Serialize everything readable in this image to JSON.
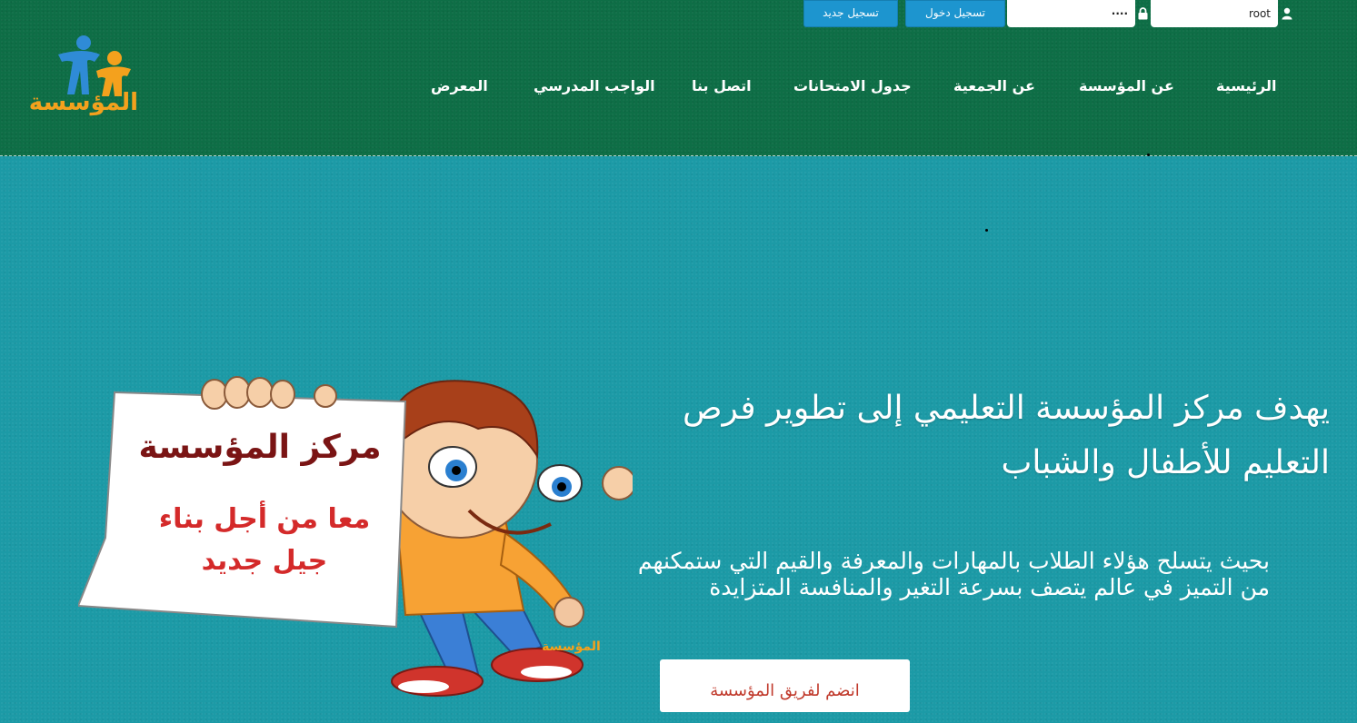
{
  "login": {
    "username_value": "root",
    "password_value": "····",
    "login_label": "تسجيل دخول",
    "register_label": "تسجيل جديد"
  },
  "logo": {
    "text": "المؤسسة"
  },
  "nav": {
    "items": [
      {
        "label": "الرئيسية"
      },
      {
        "label": "عن المؤسسة"
      },
      {
        "label": "عن الجمعية"
      },
      {
        "label": "جدول الامتحانات"
      },
      {
        "label": "اتصل بنا"
      },
      {
        "label": "الواجب المدرسي"
      },
      {
        "label": "المعرض"
      }
    ]
  },
  "hero": {
    "title": "يهدف مركز المؤسسة التعليمي إلى تطوير فرص التعليم للأطفال والشباب",
    "body": "بحيث يتسلح هؤلاء الطلاب بالمهارات والمعرفة والقيم التي ستمكنهم من التميز في عالم يتصف بسرعة التغير والمنافسة المتزايدة",
    "cta_label": "انضم لفريق المؤسسة"
  },
  "illustration": {
    "sign_title": "مركز المؤسسة",
    "sign_line1": "معا من أجل بناء",
    "sign_line2": "جيل جديد",
    "badge_text": "المؤسسة"
  },
  "colors": {
    "header_bg": "#0e6e46",
    "hero_bg": "#1c9aa6",
    "button_blue": "#1d95cf",
    "cta_text": "#c0392b",
    "sign_title": "#7a1414",
    "sign_red": "#d42a2a"
  }
}
